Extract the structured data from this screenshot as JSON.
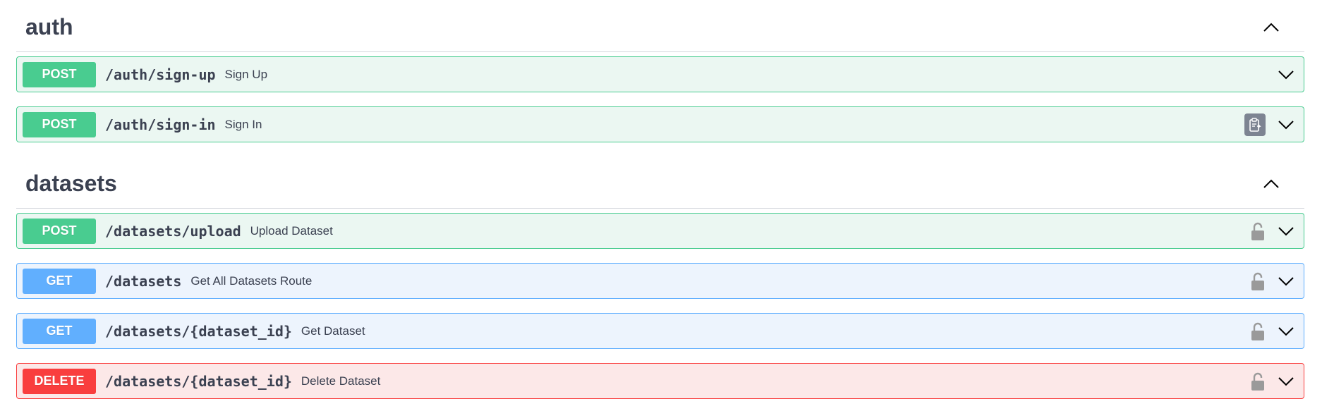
{
  "sections": [
    {
      "title": "auth",
      "operations": [
        {
          "method": "POST",
          "method_class": "post",
          "path": "/auth/sign-up",
          "summary": "Sign Up",
          "icon": "none"
        },
        {
          "method": "POST",
          "method_class": "post",
          "path": "/auth/sign-in",
          "summary": "Sign In",
          "icon": "copy"
        }
      ]
    },
    {
      "title": "datasets",
      "operations": [
        {
          "method": "POST",
          "method_class": "post",
          "path": "/datasets/upload",
          "summary": "Upload Dataset",
          "icon": "lock"
        },
        {
          "method": "GET",
          "method_class": "get",
          "path": "/datasets",
          "summary": "Get All Datasets Route",
          "icon": "lock"
        },
        {
          "method": "GET",
          "method_class": "get",
          "path": "/datasets/{dataset_id}",
          "summary": "Get Dataset",
          "icon": "lock"
        },
        {
          "method": "DELETE",
          "method_class": "delete",
          "path": "/datasets/{dataset_id}",
          "summary": "Delete Dataset",
          "icon": "lock"
        }
      ]
    }
  ],
  "colors": {
    "post": "#49cc90",
    "get": "#61affe",
    "delete": "#f93e3e",
    "text": "#3b4151"
  }
}
